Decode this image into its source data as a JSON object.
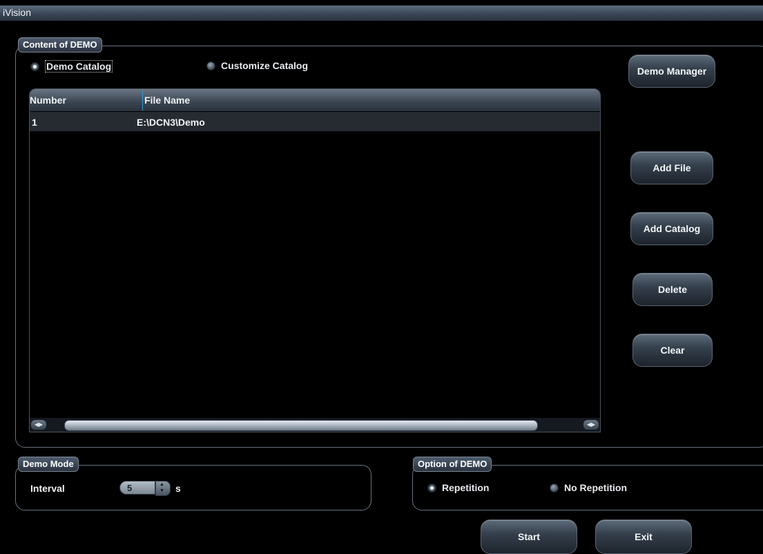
{
  "window": {
    "title": "iVision"
  },
  "content_group": {
    "legend": "Content of DEMO",
    "radios": [
      {
        "label": "Demo Catalog",
        "checked": true
      },
      {
        "label": "Customize Catalog",
        "checked": false
      }
    ],
    "table": {
      "columns": [
        "Number",
        "File Name"
      ],
      "rows": [
        {
          "number": "1",
          "file_name": "E:\\DCN3\\Demo"
        }
      ]
    }
  },
  "side_buttons": {
    "demo_manager": "Demo Manager",
    "add_file": "Add File",
    "add_catalog": "Add Catalog",
    "delete": "Delete",
    "clear": "Clear"
  },
  "demo_mode": {
    "legend": "Demo Mode",
    "interval_label": "Interval",
    "interval_value": "5",
    "unit": "s"
  },
  "option_group": {
    "legend": "Option of DEMO",
    "radios": [
      {
        "label": "Repetition",
        "checked": true
      },
      {
        "label": "No Repetition",
        "checked": false
      }
    ]
  },
  "footer": {
    "start": "Start",
    "exit": "Exit"
  },
  "colors": {
    "background": "#000000",
    "accent": "#2aa0d8"
  }
}
